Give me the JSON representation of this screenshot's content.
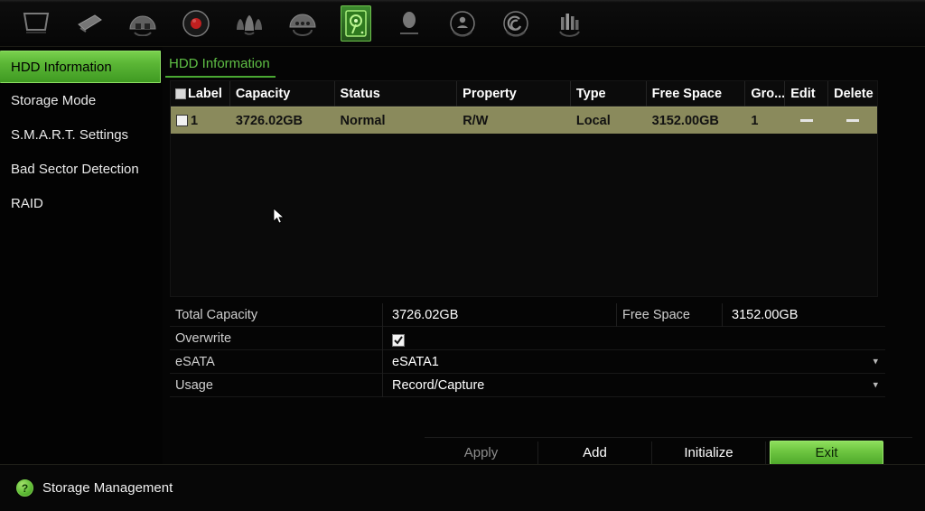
{
  "topbar": {
    "icons": [
      {
        "name": "playback-monitor-icon",
        "label": "Playback",
        "active": false
      },
      {
        "name": "camera-export-icon",
        "label": "Export",
        "active": false
      },
      {
        "name": "camera-setup-icon",
        "label": "Camera",
        "active": false
      },
      {
        "name": "record-icon",
        "label": "Record",
        "active": false
      },
      {
        "name": "alarm-icon",
        "label": "Alarm",
        "active": false
      },
      {
        "name": "network-icon",
        "label": "Network",
        "active": false
      },
      {
        "name": "hdd-storage-icon",
        "label": "Storage Management",
        "active": true
      },
      {
        "name": "user-icon",
        "label": "User",
        "active": false
      },
      {
        "name": "system-config-icon",
        "label": "System Configuration",
        "active": false
      },
      {
        "name": "maintenance-icon",
        "label": "Maintenance",
        "active": false
      },
      {
        "name": "shutdown-icon",
        "label": "Shutdown",
        "active": false
      }
    ]
  },
  "sidebar": {
    "items": [
      {
        "label": "HDD Information",
        "active": true
      },
      {
        "label": "Storage Mode",
        "active": false
      },
      {
        "label": "S.M.A.R.T. Settings",
        "active": false
      },
      {
        "label": "Bad Sector Detection",
        "active": false
      },
      {
        "label": "RAID",
        "active": false
      }
    ]
  },
  "tabs": [
    {
      "label": "HDD Information",
      "active": true
    }
  ],
  "table": {
    "headers": {
      "label": "Label",
      "capacity": "Capacity",
      "status": "Status",
      "property": "Property",
      "type": "Type",
      "free_space": "Free Space",
      "group": "Gro...",
      "edit": "Edit",
      "delete": "Delete"
    },
    "rows": [
      {
        "checked": false,
        "label": "1",
        "capacity": "3726.02GB",
        "status": "Normal",
        "property": "R/W",
        "type": "Local",
        "free_space": "3152.00GB",
        "group": "1",
        "edit": "—",
        "delete": "—"
      }
    ]
  },
  "info": {
    "total_capacity_label": "Total Capacity",
    "total_capacity_value": "3726.02GB",
    "free_space_label": "Free Space",
    "free_space_value": "3152.00GB",
    "overwrite_label": "Overwrite",
    "overwrite_checked": true,
    "esata_label": "eSATA",
    "esata_value": "eSATA1",
    "usage_label": "Usage",
    "usage_value": "Record/Capture"
  },
  "buttons": {
    "apply": "Apply",
    "add": "Add",
    "initialize": "Initialize",
    "exit": "Exit"
  },
  "statusbar": {
    "help_glyph": "?",
    "text": "Storage Management"
  },
  "colors": {
    "accent_green": "#5db837",
    "tab_green": "#5fbf45",
    "selected_row": "#8a8a5c",
    "background": "#040404"
  }
}
